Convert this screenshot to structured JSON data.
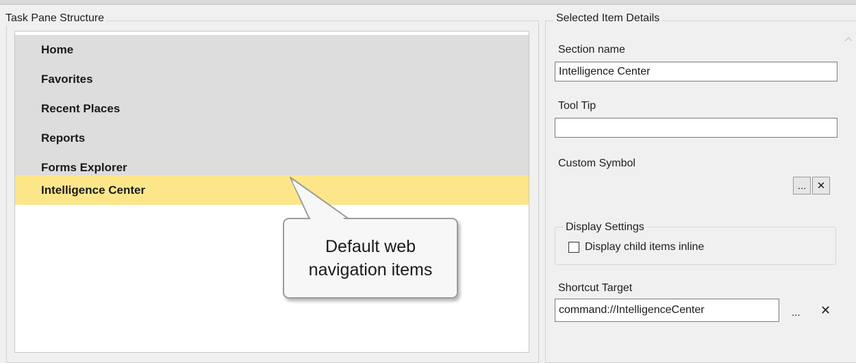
{
  "task_pane": {
    "title": "Task Pane Structure",
    "items": [
      {
        "label": "Home",
        "selected": false
      },
      {
        "label": "Favorites",
        "selected": false
      },
      {
        "label": "Recent Places",
        "selected": false
      },
      {
        "label": "Reports",
        "selected": false
      },
      {
        "label": "Forms Explorer",
        "selected": false
      },
      {
        "label": "Intelligence Center",
        "selected": true
      }
    ]
  },
  "callout": {
    "line1": "Default web",
    "line2": "navigation items"
  },
  "details": {
    "title": "Selected Item Details",
    "section_name_label": "Section name",
    "section_name_value": "Intelligence Center",
    "tooltip_label": "Tool Tip",
    "tooltip_value": "",
    "custom_symbol_label": "Custom Symbol",
    "browse_button_label": "...",
    "clear_button_label": "✕",
    "display_settings_label": "Display Settings",
    "display_child_inline_label": "Display child items inline",
    "display_child_inline_checked": false,
    "shortcut_target_label": "Shortcut Target",
    "shortcut_target_value": "command://IntelligenceCenter",
    "shortcut_browse_label": "...",
    "shortcut_clear_label": "✕"
  },
  "colors": {
    "list_item_bg": "#dddddd",
    "selected_item_bg": "#fde68a",
    "window_bg": "#f0f0f0"
  }
}
